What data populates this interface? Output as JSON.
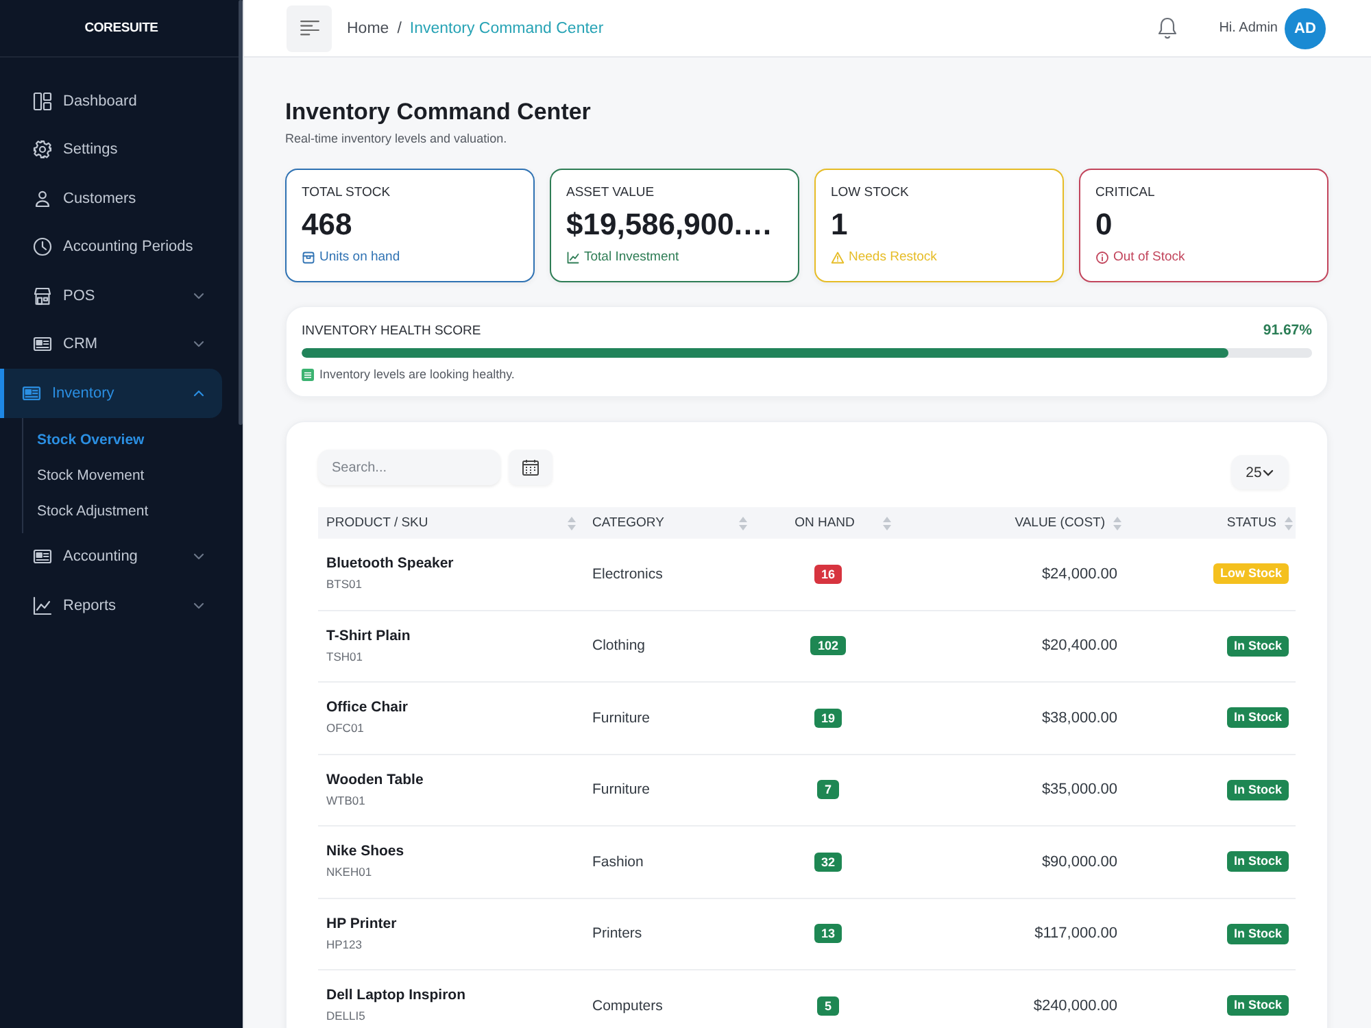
{
  "sidebar": {
    "logo": "CORESUITE",
    "items": [
      {
        "label": "Dashboard",
        "kind": "link",
        "selected": false
      },
      {
        "label": "Settings",
        "kind": "link",
        "selected": false
      },
      {
        "label": "Customers",
        "kind": "link",
        "selected": false
      },
      {
        "label": "Accounting Periods",
        "kind": "link",
        "selected": false
      },
      {
        "label": "POS",
        "kind": "group",
        "selected": false,
        "expanded": false
      },
      {
        "label": "CRM",
        "kind": "group",
        "selected": false,
        "expanded": false
      },
      {
        "label": "Inventory",
        "kind": "group",
        "selected": true,
        "expanded": true,
        "children": [
          {
            "label": "Stock Overview",
            "selected": true
          },
          {
            "label": "Stock Movement",
            "selected": false
          },
          {
            "label": "Stock Adjustment",
            "selected": false
          }
        ]
      },
      {
        "label": "Accounting",
        "kind": "group",
        "selected": false,
        "expanded": false
      },
      {
        "label": "Reports",
        "kind": "group",
        "selected": false,
        "expanded": false
      }
    ]
  },
  "header": {
    "breadcrumb": {
      "items": [
        "Home",
        "Inventory Command Center"
      ],
      "separator": "/"
    },
    "greeting": "Hi. Admin",
    "avatar": "AD"
  },
  "page": {
    "title": "Inventory Command Center",
    "subtitle": "Real-time inventory levels and valuation."
  },
  "stats": [
    {
      "label": "TOTAL STOCK",
      "value": "468",
      "note": "Units on hand",
      "color": "#2f72b3"
    },
    {
      "label": "ASSET VALUE",
      "value": "$19,586,900.…",
      "note": "Total Investment",
      "color": "#2e7d55"
    },
    {
      "label": "LOW STOCK",
      "value": "1",
      "note": "Needs Restock",
      "color": "#e6bc26"
    },
    {
      "label": "CRITICAL",
      "value": "0",
      "note": "Out of Stock",
      "color": "#c2455c"
    }
  ],
  "health": {
    "label": "INVENTORY HEALTH SCORE",
    "reading": "91.67%",
    "level": 0.9167,
    "note": "Inventory levels are looking healthy."
  },
  "table": {
    "search": {
      "placeholder": "Search..."
    },
    "page_size": "25",
    "columns": [
      "PRODUCT / SKU",
      "CATEGORY",
      "ON HAND",
      "VALUE (COST)",
      "STATUS"
    ],
    "rows": [
      {
        "name": "Bluetooth Speaker",
        "sku": "BTS01",
        "category": "Electronics",
        "on_hand": {
          "value": "16",
          "color": "#d7343f"
        },
        "value": "$24,000.00",
        "status": {
          "label": "Low Stock",
          "color": "#f4c01e"
        }
      },
      {
        "name": "T-Shirt Plain",
        "sku": "TSH01",
        "category": "Clothing",
        "on_hand": {
          "value": "102",
          "color": "#1e8753"
        },
        "value": "$20,400.00",
        "status": {
          "label": "In Stock",
          "color": "#1e8753"
        }
      },
      {
        "name": "Office Chair",
        "sku": "OFC01",
        "category": "Furniture",
        "on_hand": {
          "value": "19",
          "color": "#1e8753"
        },
        "value": "$38,000.00",
        "status": {
          "label": "In Stock",
          "color": "#1e8753"
        }
      },
      {
        "name": "Wooden Table",
        "sku": "WTB01",
        "category": "Furniture",
        "on_hand": {
          "value": "7",
          "color": "#1e8753"
        },
        "value": "$35,000.00",
        "status": {
          "label": "In Stock",
          "color": "#1e8753"
        }
      },
      {
        "name": "Nike Shoes",
        "sku": "NKEH01",
        "category": "Fashion",
        "on_hand": {
          "value": "32",
          "color": "#1e8753"
        },
        "value": "$90,000.00",
        "status": {
          "label": "In Stock",
          "color": "#1e8753"
        }
      },
      {
        "name": "HP Printer",
        "sku": "HP123",
        "category": "Printers",
        "on_hand": {
          "value": "13",
          "color": "#1e8753"
        },
        "value": "$117,000.00",
        "status": {
          "label": "In Stock",
          "color": "#1e8753"
        }
      },
      {
        "name": "Dell Laptop Inspiron",
        "sku": "DELLI5",
        "category": "Computers",
        "on_hand": {
          "value": "5",
          "color": "#1e8753"
        },
        "value": "$240,000.00",
        "status": {
          "label": "In Stock",
          "color": "#1e8753"
        }
      }
    ]
  }
}
